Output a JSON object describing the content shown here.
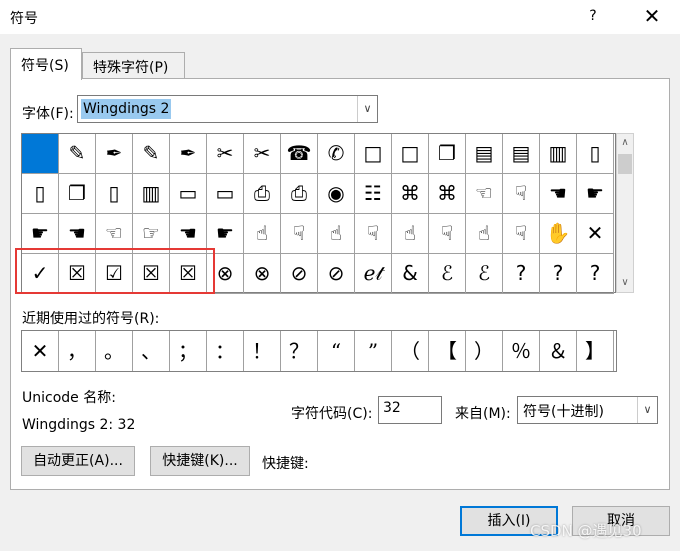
{
  "window": {
    "title": "符号",
    "help": "?",
    "close": "✕"
  },
  "tabs": [
    {
      "label": "符号(S)",
      "active": true
    },
    {
      "label": "特殊字符(P)",
      "active": false
    }
  ],
  "font": {
    "label": "字体(F):",
    "value": "Wingdings 2"
  },
  "symbol_grid": {
    "rows": [
      [
        "",
        "✎",
        "✒",
        "✎",
        "✒",
        "✂",
        "✂",
        "☎",
        "✆",
        "□",
        "□",
        "❐",
        "▤",
        "▤",
        "▥",
        "▯"
      ],
      [
        "▯",
        "❐",
        "▯",
        "▥",
        "▭",
        "▭",
        "⎙",
        "⎙",
        "◉",
        "☷",
        "⌘",
        "⌘",
        "☜",
        "☟",
        "☚",
        "☛"
      ],
      [
        "☛",
        "☚",
        "☜",
        "☞",
        "☚",
        "☛",
        "☝",
        "☟",
        "☝",
        "☟",
        "☝",
        "☟",
        "☝",
        "☟",
        "✋",
        "✕"
      ],
      [
        "✓",
        "☒",
        "☑",
        "☒",
        "☒",
        "⊗",
        "⊗",
        "⊘",
        "⊘",
        "ℯ𝓉",
        "&",
        "ℰ",
        "ℰ",
        "?",
        "?",
        "?"
      ]
    ],
    "selected_index": 0
  },
  "recent": {
    "label": "近期使用过的符号(R):",
    "symbols": [
      "✕",
      "，",
      "。",
      "、",
      "；",
      "：",
      "！",
      "？",
      "“",
      "”",
      "（",
      "【",
      "）",
      "％",
      "＆",
      "】"
    ]
  },
  "unicode": {
    "label": "Unicode 名称:",
    "value": "Wingdings 2: 32"
  },
  "char_code": {
    "label": "字符代码(C):",
    "value": "32"
  },
  "from": {
    "label": "来自(M):",
    "value": "符号(十进制)"
  },
  "buttons": {
    "autocorrect": "自动更正(A)...",
    "shortcut_key": "快捷键(K)...",
    "insert": "插入(I)",
    "cancel": "取消"
  },
  "shortcut_label": "快捷键:",
  "watermark": "CSDN @遇见30",
  "colors": {
    "selection": "#0078d7",
    "highlight_box": "#e53935",
    "font_selection": "#99c9ef"
  }
}
